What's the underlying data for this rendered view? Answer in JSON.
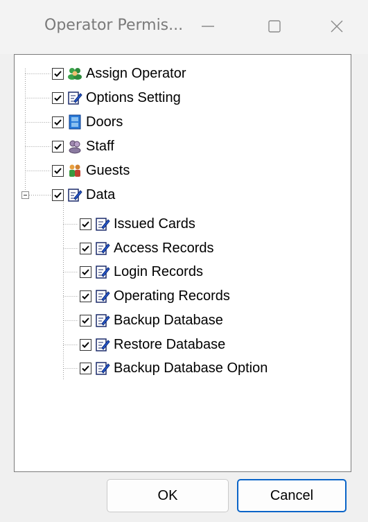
{
  "window": {
    "title": "Operator Permis...",
    "minimize_icon": "minimize-icon",
    "maximize_icon": "maximize-icon",
    "close_icon": "close-icon"
  },
  "tree": {
    "collapse_icon": "minus-box-icon",
    "items": [
      {
        "label": "Assign Operator",
        "icon": "operator-group-icon",
        "checked": true
      },
      {
        "label": "Options Setting",
        "icon": "edit-document-icon",
        "checked": true
      },
      {
        "label": "Doors",
        "icon": "door-icon",
        "checked": true
      },
      {
        "label": "Staff",
        "icon": "staff-icon",
        "checked": true
      },
      {
        "label": "Guests",
        "icon": "guests-icon",
        "checked": true
      },
      {
        "label": "Data",
        "icon": "edit-document-icon",
        "checked": true
      },
      {
        "label": "Issued Cards",
        "icon": "edit-document-icon",
        "checked": true
      },
      {
        "label": "Access Records",
        "icon": "edit-document-icon",
        "checked": true
      },
      {
        "label": "Login Records",
        "icon": "edit-document-icon",
        "checked": true
      },
      {
        "label": "Operating Records",
        "icon": "edit-document-icon",
        "checked": true
      },
      {
        "label": "Backup Database",
        "icon": "edit-document-icon",
        "checked": true
      },
      {
        "label": "Restore Database",
        "icon": "edit-document-icon",
        "checked": true
      },
      {
        "label": "Backup Database Option",
        "icon": "edit-document-icon",
        "checked": true
      }
    ]
  },
  "buttons": {
    "ok": "OK",
    "cancel": "Cancel"
  },
  "colors": {
    "accent": "#0a64c8",
    "window_bg": "#f0f0f0",
    "tree_bg": "#ffffff"
  }
}
